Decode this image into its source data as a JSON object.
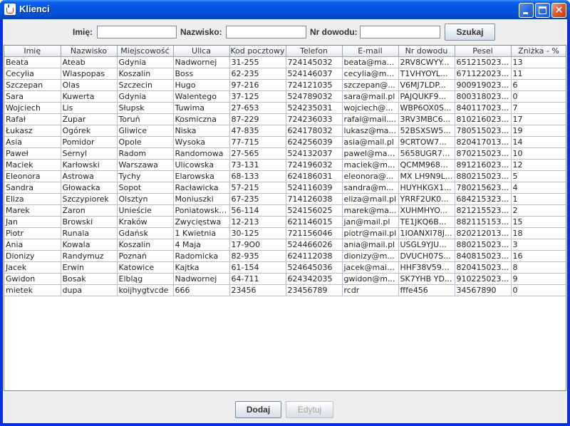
{
  "window": {
    "title": "Klienci"
  },
  "search": {
    "imie_label": "Imię:",
    "nazwisko_label": "Nazwisko:",
    "nr_dowodu_label": "Nr dowodu:",
    "imie_value": "",
    "nazwisko_value": "",
    "nr_dowodu_value": "",
    "search_button": "Szukaj"
  },
  "table": {
    "columns": [
      "Imię",
      "Nazwisko",
      "Miejscowość",
      "Ulica",
      "Kod pocztowy",
      "Telefon",
      "E-mail",
      "Nr dowodu",
      "Pesel",
      "Zniżka - %"
    ],
    "rows": [
      [
        "Beata",
        "Ateab",
        "Gdynia",
        "Nadwornej",
        "31-255",
        "724145032",
        "beata@mail....",
        "2RV8CWYY...",
        "651215023...",
        "13"
      ],
      [
        "Cecylia",
        "Wlaspopas",
        "Koszalin",
        "Boss",
        "62-235",
        "524146037",
        "cecylia@ma...",
        "T1VHYOYL...",
        "671122023...",
        "11"
      ],
      [
        "Szczepan",
        "Olas",
        "Szczecin",
        "Hugo",
        "97-216",
        "724121035",
        "szczepan@...",
        "V6MJ7LDP...",
        "900919023...",
        "6"
      ],
      [
        "Sara",
        "Kuwerta",
        "Gdynia",
        "Walentego",
        "37-125",
        "524789032",
        "sara@mail.pl",
        "PAJQUKF9...",
        "800318023...",
        "0"
      ],
      [
        "Wojciech",
        "Lis",
        "Słupsk",
        "Tuwima",
        "27-653",
        "524235031",
        "wojciech@...",
        "WBP6OX0S...",
        "840117023...",
        "7"
      ],
      [
        "Rafał",
        "Zupar",
        "Toruń",
        "Kosmiczna",
        "87-229",
        "724236033",
        "rafal@mail....",
        "3RV3MBC6...",
        "810216023...",
        "17"
      ],
      [
        "Łukasz",
        "Ogórek",
        "Gliwice",
        "Niska",
        "47-835",
        "624178032",
        "lukasz@ma...",
        "52BSXSW5...",
        "780515023...",
        "19"
      ],
      [
        "Asia",
        "Pomidor",
        "Opole",
        "Wysoka",
        "77-715",
        "624256039",
        "asia@mail.pl",
        "9CRTOW7...",
        "820417013...",
        "14"
      ],
      [
        "Paweł",
        "Sernyl",
        "Radom",
        "Randomowa",
        "27-565",
        "524132037",
        "pawel@mai...",
        "5658UGR7...",
        "870215023...",
        "10"
      ],
      [
        "Maciek",
        "Karłowski",
        "Warszawa",
        "Ulicowska",
        "73-131",
        "724196032",
        "maciek@m...",
        "QCMM968K...",
        "891216023...",
        "12"
      ],
      [
        "Eleonora",
        "Astrowa",
        "Tychy",
        "Elarowska",
        "68-133",
        "624186031",
        "eleonora@...",
        "MX LH9N9L...",
        "880215023...",
        "5"
      ],
      [
        "Sandra",
        "Głowacka",
        "Sopot",
        "Racławicka",
        "57-215",
        "524116039",
        "sandra@m...",
        "HUYHKGX1...",
        "780215623...",
        "4"
      ],
      [
        "Eliza",
        "Szczypiorek",
        "Olsztyn",
        "Moniuszki",
        "67-235",
        "714126038",
        "eliza@mail.pl",
        "YRRF2UK0...",
        "684215323...",
        "1"
      ],
      [
        "Marek",
        "Zaron",
        "Unieście",
        "Poniatowski...",
        "56-114",
        "524156025",
        "marek@ma...",
        "XUHMHYO...",
        "821215523...",
        "2"
      ],
      [
        "Jan",
        "Browski",
        "Kraków",
        "Zwycięstwa",
        "12-213",
        "621146015",
        "jan@mail.pl",
        "TE1JKQ6B...",
        "882115153...",
        "15"
      ],
      [
        "Piotr",
        "Runala",
        "Gdańsk",
        "1 Kwietnia",
        "30-125",
        "721156046",
        "piotr@mail.pl",
        "1IOANXI78J...",
        "820212013...",
        "18"
      ],
      [
        "Ania",
        "Kowala",
        "Koszalin",
        "4 Maja",
        "17-9O0",
        "524466026",
        "ania@mail.pl",
        "USGL9YJU...",
        "880215023...",
        "3"
      ],
      [
        "Dionizy",
        "Randymuz",
        "Poznań",
        "Radomicka",
        "82-935",
        "624112038",
        "dionizy@m...",
        "DVUCH07S...",
        "840815023...",
        "16"
      ],
      [
        "Jacek",
        "Erwin",
        "Katowice",
        "Kajtka",
        "61-154",
        "524645036",
        "jacek@mail....",
        "HHF38V591...",
        "820415023...",
        "8"
      ],
      [
        "Gwidon",
        "Bosak",
        "Elbląg",
        "Nadwornej",
        "64-711",
        "624342035",
        "gwidon@m...",
        "SK7YHB YD...",
        "910225023...",
        "9"
      ],
      [
        "mietek",
        "dupa",
        "koijhygtvcde",
        "666",
        "23456",
        "23456789",
        "rcdr",
        "fffe456",
        "34567890",
        "0"
      ]
    ]
  },
  "actions": {
    "add_button": "Dodaj",
    "edit_button": "Edytuj"
  },
  "icons": {
    "app": "java-cup-icon",
    "minimize": "minimize-icon",
    "maximize": "maximize-icon",
    "close": "close-icon"
  }
}
